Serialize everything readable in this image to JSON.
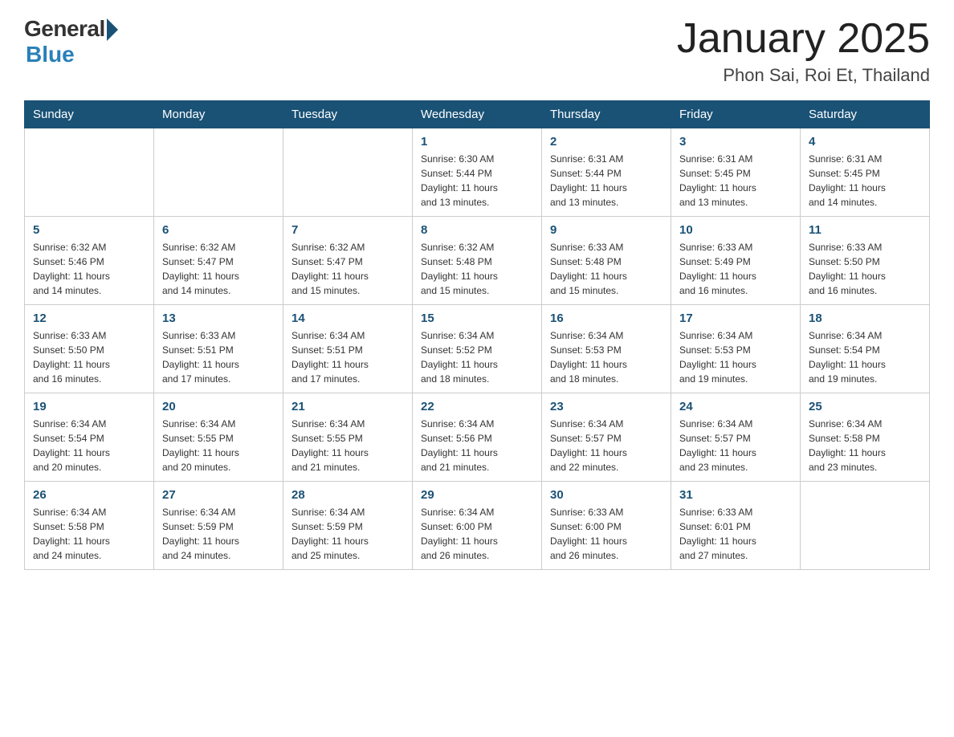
{
  "header": {
    "logo_general": "General",
    "logo_blue": "Blue",
    "month_title": "January 2025",
    "location": "Phon Sai, Roi Et, Thailand"
  },
  "weekdays": [
    "Sunday",
    "Monday",
    "Tuesday",
    "Wednesday",
    "Thursday",
    "Friday",
    "Saturday"
  ],
  "weeks": [
    [
      {
        "day": "",
        "info": ""
      },
      {
        "day": "",
        "info": ""
      },
      {
        "day": "",
        "info": ""
      },
      {
        "day": "1",
        "info": "Sunrise: 6:30 AM\nSunset: 5:44 PM\nDaylight: 11 hours\nand 13 minutes."
      },
      {
        "day": "2",
        "info": "Sunrise: 6:31 AM\nSunset: 5:44 PM\nDaylight: 11 hours\nand 13 minutes."
      },
      {
        "day": "3",
        "info": "Sunrise: 6:31 AM\nSunset: 5:45 PM\nDaylight: 11 hours\nand 13 minutes."
      },
      {
        "day": "4",
        "info": "Sunrise: 6:31 AM\nSunset: 5:45 PM\nDaylight: 11 hours\nand 14 minutes."
      }
    ],
    [
      {
        "day": "5",
        "info": "Sunrise: 6:32 AM\nSunset: 5:46 PM\nDaylight: 11 hours\nand 14 minutes."
      },
      {
        "day": "6",
        "info": "Sunrise: 6:32 AM\nSunset: 5:47 PM\nDaylight: 11 hours\nand 14 minutes."
      },
      {
        "day": "7",
        "info": "Sunrise: 6:32 AM\nSunset: 5:47 PM\nDaylight: 11 hours\nand 15 minutes."
      },
      {
        "day": "8",
        "info": "Sunrise: 6:32 AM\nSunset: 5:48 PM\nDaylight: 11 hours\nand 15 minutes."
      },
      {
        "day": "9",
        "info": "Sunrise: 6:33 AM\nSunset: 5:48 PM\nDaylight: 11 hours\nand 15 minutes."
      },
      {
        "day": "10",
        "info": "Sunrise: 6:33 AM\nSunset: 5:49 PM\nDaylight: 11 hours\nand 16 minutes."
      },
      {
        "day": "11",
        "info": "Sunrise: 6:33 AM\nSunset: 5:50 PM\nDaylight: 11 hours\nand 16 minutes."
      }
    ],
    [
      {
        "day": "12",
        "info": "Sunrise: 6:33 AM\nSunset: 5:50 PM\nDaylight: 11 hours\nand 16 minutes."
      },
      {
        "day": "13",
        "info": "Sunrise: 6:33 AM\nSunset: 5:51 PM\nDaylight: 11 hours\nand 17 minutes."
      },
      {
        "day": "14",
        "info": "Sunrise: 6:34 AM\nSunset: 5:51 PM\nDaylight: 11 hours\nand 17 minutes."
      },
      {
        "day": "15",
        "info": "Sunrise: 6:34 AM\nSunset: 5:52 PM\nDaylight: 11 hours\nand 18 minutes."
      },
      {
        "day": "16",
        "info": "Sunrise: 6:34 AM\nSunset: 5:53 PM\nDaylight: 11 hours\nand 18 minutes."
      },
      {
        "day": "17",
        "info": "Sunrise: 6:34 AM\nSunset: 5:53 PM\nDaylight: 11 hours\nand 19 minutes."
      },
      {
        "day": "18",
        "info": "Sunrise: 6:34 AM\nSunset: 5:54 PM\nDaylight: 11 hours\nand 19 minutes."
      }
    ],
    [
      {
        "day": "19",
        "info": "Sunrise: 6:34 AM\nSunset: 5:54 PM\nDaylight: 11 hours\nand 20 minutes."
      },
      {
        "day": "20",
        "info": "Sunrise: 6:34 AM\nSunset: 5:55 PM\nDaylight: 11 hours\nand 20 minutes."
      },
      {
        "day": "21",
        "info": "Sunrise: 6:34 AM\nSunset: 5:55 PM\nDaylight: 11 hours\nand 21 minutes."
      },
      {
        "day": "22",
        "info": "Sunrise: 6:34 AM\nSunset: 5:56 PM\nDaylight: 11 hours\nand 21 minutes."
      },
      {
        "day": "23",
        "info": "Sunrise: 6:34 AM\nSunset: 5:57 PM\nDaylight: 11 hours\nand 22 minutes."
      },
      {
        "day": "24",
        "info": "Sunrise: 6:34 AM\nSunset: 5:57 PM\nDaylight: 11 hours\nand 23 minutes."
      },
      {
        "day": "25",
        "info": "Sunrise: 6:34 AM\nSunset: 5:58 PM\nDaylight: 11 hours\nand 23 minutes."
      }
    ],
    [
      {
        "day": "26",
        "info": "Sunrise: 6:34 AM\nSunset: 5:58 PM\nDaylight: 11 hours\nand 24 minutes."
      },
      {
        "day": "27",
        "info": "Sunrise: 6:34 AM\nSunset: 5:59 PM\nDaylight: 11 hours\nand 24 minutes."
      },
      {
        "day": "28",
        "info": "Sunrise: 6:34 AM\nSunset: 5:59 PM\nDaylight: 11 hours\nand 25 minutes."
      },
      {
        "day": "29",
        "info": "Sunrise: 6:34 AM\nSunset: 6:00 PM\nDaylight: 11 hours\nand 26 minutes."
      },
      {
        "day": "30",
        "info": "Sunrise: 6:33 AM\nSunset: 6:00 PM\nDaylight: 11 hours\nand 26 minutes."
      },
      {
        "day": "31",
        "info": "Sunrise: 6:33 AM\nSunset: 6:01 PM\nDaylight: 11 hours\nand 27 minutes."
      },
      {
        "day": "",
        "info": ""
      }
    ]
  ]
}
